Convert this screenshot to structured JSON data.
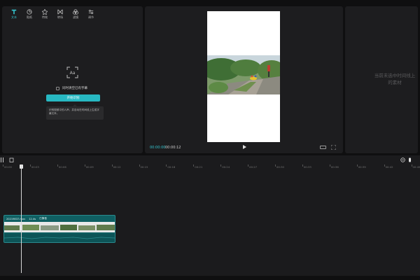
{
  "toolbar": {
    "tools": [
      {
        "label": "文本",
        "icon": "text-icon"
      },
      {
        "label": "贴纸",
        "icon": "sticker-icon"
      },
      {
        "label": "特效",
        "icon": "effects-icon"
      },
      {
        "label": "转场",
        "icon": "transition-icon"
      },
      {
        "label": "滤镜",
        "icon": "filter-icon"
      },
      {
        "label": "调节",
        "icon": "adjust-icon"
      }
    ]
  },
  "caption_panel": {
    "checkbox_label": "同时清空已有字幕",
    "start_button": "开始识别",
    "tip": "识别视频中的人声，并自动在时间线上生成字幕文本。"
  },
  "player": {
    "current_time": "00:00:00",
    "total_time": "00:00:12"
  },
  "properties": {
    "empty_message": "当前未选中时间线上的素材"
  },
  "timeline": {
    "ticks": [
      "00:00",
      "00:03",
      "00:06",
      "00:09",
      "00:12",
      "00:15",
      "00:18",
      "00:21",
      "00:24",
      "00:27",
      "00:30",
      "00:33",
      "00:36",
      "00:39",
      "00:42",
      "00:45"
    ],
    "clip": {
      "name": "20219837.mov",
      "duration": "12.4s",
      "audio": "已静音"
    }
  },
  "colors": {
    "accent": "#27b8c2",
    "panel": "#1d1d1f",
    "background": "#0f0f10"
  }
}
